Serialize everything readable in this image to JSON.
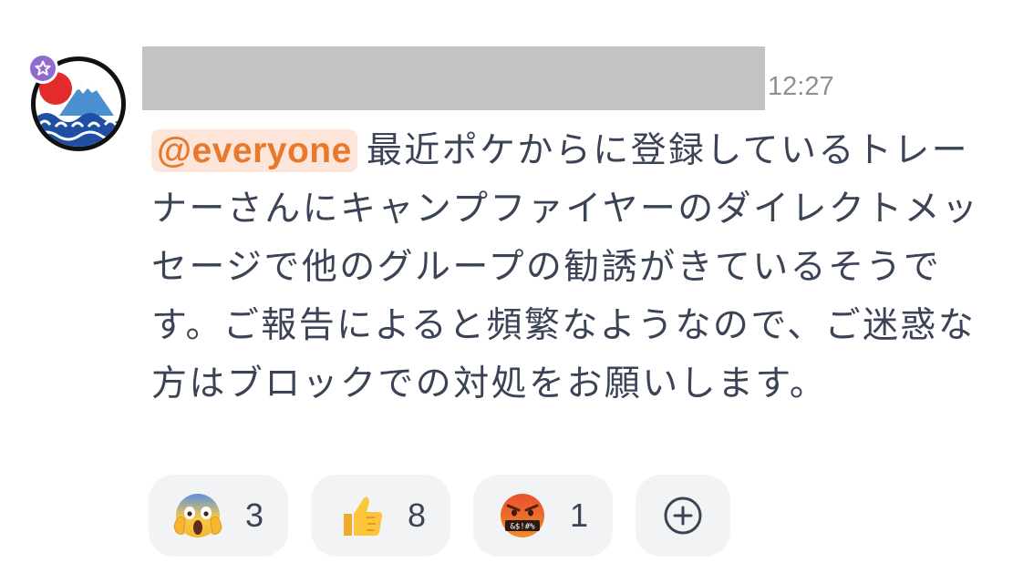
{
  "message": {
    "timestamp": "12:27",
    "mention": "@everyone",
    "text": "最近ポケからに登録しているトレーナーさんにキャンプファイヤーのダイレクトメッセージで他のグループの勧誘がきているそうです。ご報告によると頻繁なようなので、ご迷惑な方はブロックでの対処をお願いします。"
  },
  "reactions": [
    {
      "emoji": "face-screaming-in-fear-icon",
      "count": "3"
    },
    {
      "emoji": "thumbs-up-icon",
      "count": "8"
    },
    {
      "emoji": "face-with-symbols-on-mouth-icon",
      "count": "1"
    }
  ],
  "colors": {
    "mention_text": "#e7792d",
    "mention_bg": "#fde6d9",
    "role_badge": "#8f6ad0",
    "reaction_bg": "#f2f3f5"
  }
}
